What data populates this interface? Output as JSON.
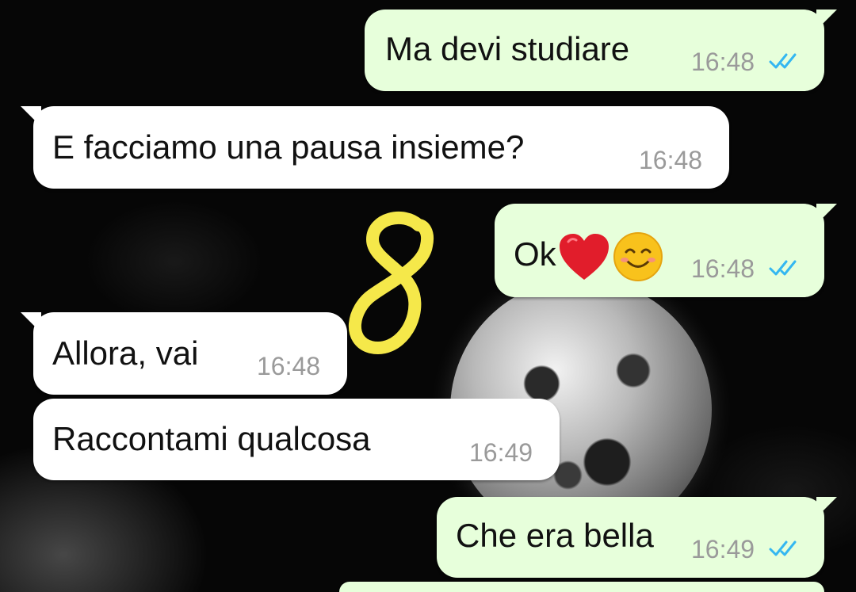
{
  "messages": [
    {
      "direction": "outgoing",
      "text": "Ma devi studiare",
      "time": "16:48",
      "status": "read"
    },
    {
      "direction": "incoming",
      "text": "E facciamo una pausa insieme?",
      "time": "16:48"
    },
    {
      "direction": "outgoing",
      "text": "Ok",
      "emojis": [
        "red-heart",
        "smiling-face"
      ],
      "time": "16:48",
      "status": "read"
    },
    {
      "direction": "incoming",
      "text": "Allora, vai",
      "time": "16:48"
    },
    {
      "direction": "incoming",
      "text": "Raccontami qualcosa",
      "time": "16:49"
    },
    {
      "direction": "outgoing",
      "text": "Che era bella",
      "time": "16:49",
      "status": "read"
    }
  ],
  "colors": {
    "outgoing_bubble": "#e7ffdb",
    "incoming_bubble": "#ffffff",
    "time_text": "#9a9a9a",
    "read_ticks": "#34b7f1",
    "sticker_stroke": "#f5e84a"
  },
  "icons": {
    "read_receipt": "double-check-icon",
    "sticker": "number-eight-doodle"
  }
}
